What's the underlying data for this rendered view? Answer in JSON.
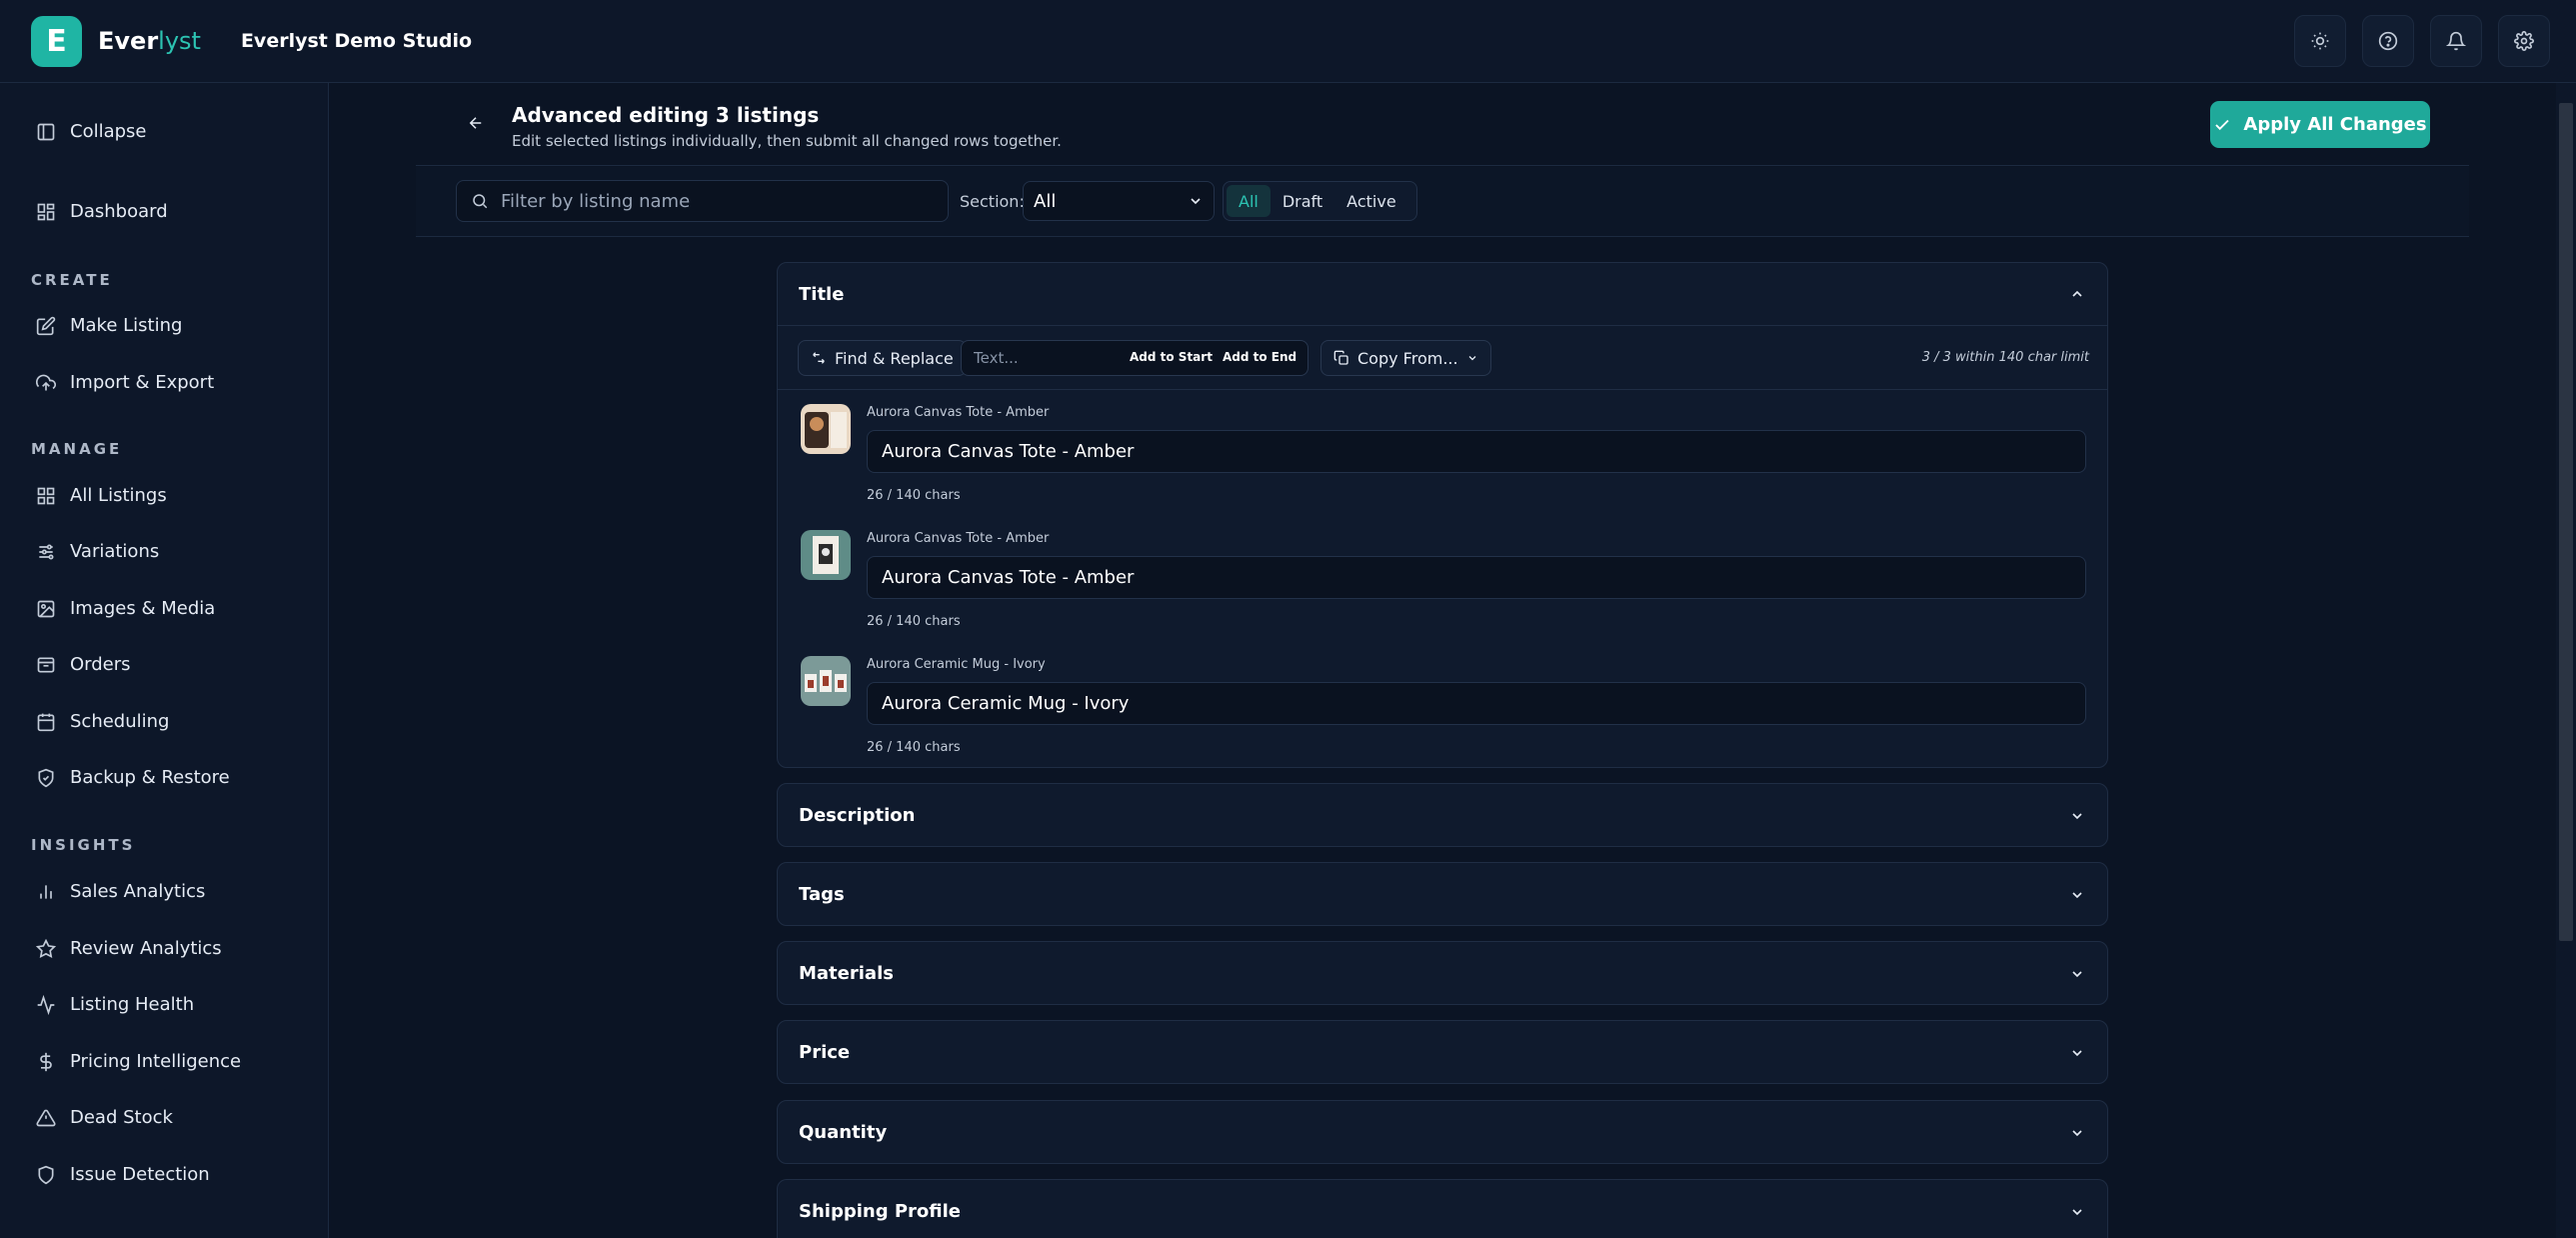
{
  "app": {
    "logo_letter": "E",
    "brand_main": "Ever",
    "brand_accent": "lyst",
    "studio": "Everlyst Demo Studio"
  },
  "topbar": {
    "icons": [
      "sun-icon",
      "help-icon",
      "bell-icon",
      "gear-icon"
    ]
  },
  "sidebar": {
    "collapse": "Collapse",
    "dashboard": "Dashboard",
    "sections": {
      "create": "CREATE",
      "manage": "MANAGE",
      "insights": "INSIGHTS"
    },
    "create_items": [
      "Make Listing",
      "Import & Export"
    ],
    "manage_items": [
      "All Listings",
      "Variations",
      "Images & Media",
      "Orders",
      "Scheduling",
      "Backup & Restore"
    ],
    "insights_items": [
      "Sales Analytics",
      "Review Analytics",
      "Listing Health",
      "Pricing Intelligence",
      "Dead Stock",
      "Issue Detection"
    ]
  },
  "header": {
    "title": "Advanced editing 3 listings",
    "subtitle": "Edit selected listings individually, then submit all changed rows together.",
    "apply_label": "Apply All Changes"
  },
  "filters": {
    "search_placeholder": "Filter by listing name",
    "section_label": "Section:",
    "section_value": "All",
    "status_tabs": [
      "All",
      "Draft",
      "Active"
    ],
    "active_status": "All"
  },
  "title_panel": {
    "heading": "Title",
    "find_replace": "Find & Replace",
    "text_placeholder": "Text...",
    "add_start": "Add to Start",
    "add_end": "Add to End",
    "copy_from": "Copy From...",
    "limit_note": "3 / 3 within 140 char limit",
    "rows": [
      {
        "label": "Aurora Canvas Tote - Amber",
        "value": "Aurora Canvas Tote - Amber",
        "count": "26 / 140 chars"
      },
      {
        "label": "Aurora Canvas Tote - Amber",
        "value": "Aurora Canvas Tote - Amber",
        "count": "26 / 140 chars"
      },
      {
        "label": "Aurora Ceramic Mug - Ivory",
        "value": "Aurora Ceramic Mug - Ivory",
        "count": "26 / 140 chars"
      }
    ]
  },
  "panels": [
    "Description",
    "Tags",
    "Materials",
    "Price",
    "Quantity",
    "Shipping Profile"
  ],
  "colors": {
    "accent": "#1fa99a",
    "background": "#0b1424"
  }
}
